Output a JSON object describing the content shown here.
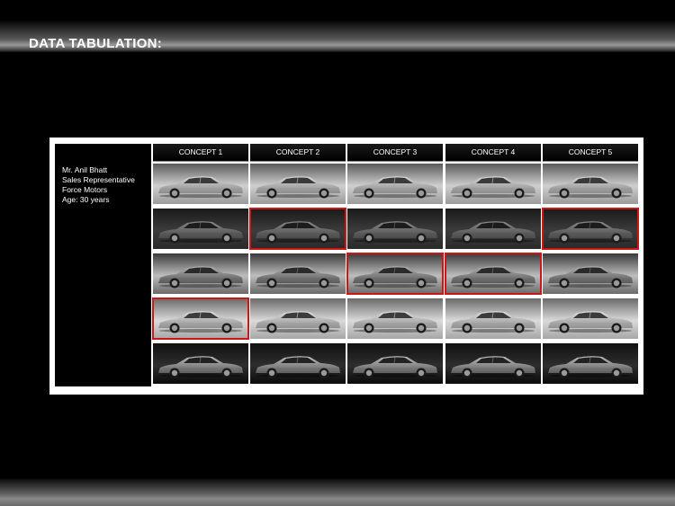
{
  "header": {
    "title": "DATA TABULATION:"
  },
  "respondent": {
    "name": "Mr. Anil Bhatt",
    "role": "Sales Representative",
    "company": "Force Motors",
    "age": "Age: 30 years"
  },
  "concepts": [
    {
      "label": "CONCEPT 1"
    },
    {
      "label": "CONCEPT 2"
    },
    {
      "label": "CONCEPT 3"
    },
    {
      "label": "CONCEPT 4"
    },
    {
      "label": "CONCEPT 5"
    }
  ],
  "grid": {
    "rows": [
      {
        "tone": "silver-studio",
        "selected": [
          false,
          false,
          false,
          false,
          false
        ]
      },
      {
        "tone": "grey-dark",
        "selected": [
          false,
          true,
          false,
          false,
          true
        ]
      },
      {
        "tone": "mixed",
        "selected": [
          false,
          false,
          true,
          true,
          false
        ]
      },
      {
        "tone": "light-silver",
        "selected": [
          true,
          false,
          false,
          false,
          false
        ]
      },
      {
        "tone": "dark-floor",
        "selected": [
          false,
          false,
          false,
          false,
          false
        ]
      }
    ]
  },
  "colors": {
    "selection": "#d11414",
    "frame": "#ffffff",
    "background": "#000000"
  },
  "icons": {
    "car": "sedan-side-view"
  }
}
